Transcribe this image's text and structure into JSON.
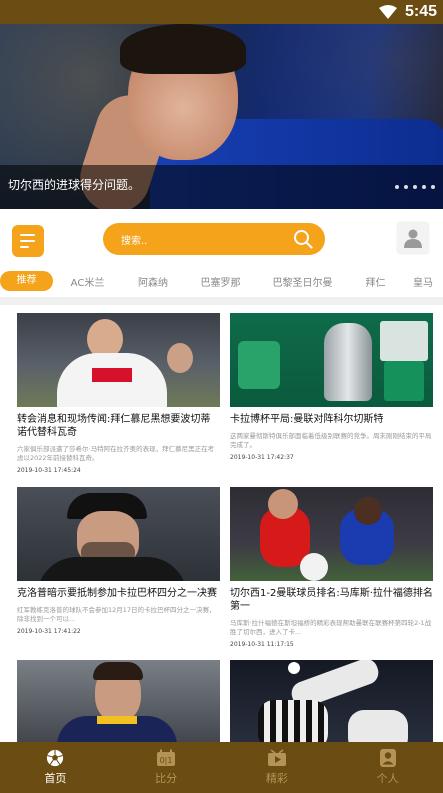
{
  "status_bar": {
    "time": "5:45"
  },
  "banner": {
    "caption": "切尔西的进球得分问题。",
    "dot_count": 5
  },
  "search": {
    "placeholder": "搜索.."
  },
  "tabs": [
    "推荐",
    "AC米兰",
    "阿森纳",
    "巴塞罗那",
    "巴黎圣日尔曼",
    "拜仁",
    "皇马"
  ],
  "active_tab": 0,
  "articles": [
    {
      "title": "转会消息和现场传闻:拜仁慕尼黑想要波切蒂诺代替科瓦奇",
      "summary": "六家俱乐部派遣了莎希尔·马特阿在拉齐奥的表现，拜仁慕尼黑正在考虑以2022年前接替科瓦奇。",
      "date": "2019-10-31 17:45:24"
    },
    {
      "title": "卡拉博杯平局:曼联对阵科尔切斯特",
      "summary": "这两家曼彻斯特俱乐部面临着低级别联赛的竞争。周末刚刚结束的平局完成了。",
      "date": "2019-10-31 17:42:37"
    },
    {
      "title": "克洛普暗示要抵制参加卡拉巴杯四分之一决赛",
      "summary": "红军教练克洛普的球队不会参加12月17日的卡拉巴杯四分之一决赛，除非找到一个可以...",
      "date": "2019-10-31 17:41:22"
    },
    {
      "title": "切尔西1-2曼联球员排名:马库斯·拉什福德排名第一",
      "summary": "马库斯·拉什福德在斯坦福桥的精彩表现帮助曼联在联赛杯第四轮2-1战胜了切尔西，进入了卡...",
      "date": "2019-10-31 11:17:15"
    },
    {
      "title": "",
      "summary": "",
      "date": ""
    },
    {
      "title": "",
      "summary": "",
      "date": ""
    }
  ],
  "bottom_nav": [
    {
      "label": "首页",
      "icon": "soccer-ball-icon"
    },
    {
      "label": "比分",
      "icon": "scoreboard-icon"
    },
    {
      "label": "精彩",
      "icon": "video-icon"
    },
    {
      "label": "个人",
      "icon": "person-icon"
    }
  ],
  "colors": {
    "accent": "#f5a31a",
    "brand_dark": "#6b4c12",
    "nav_inactive": "#b59357"
  }
}
